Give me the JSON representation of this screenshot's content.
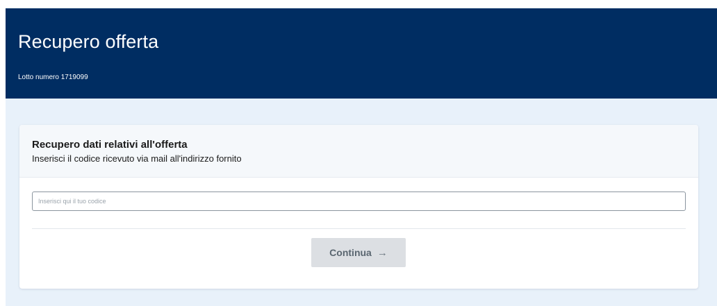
{
  "header": {
    "title": "Recupero offerta",
    "subtitle": "Lotto numero 1719099"
  },
  "card": {
    "title": "Recupero dati relativi all'offerta",
    "subtitle": "Inserisci il codice ricevuto via mail all'indirizzo fornito",
    "code_input": {
      "value": "",
      "placeholder": "Inserisci qui il tuo codice"
    },
    "continue_button": {
      "label": "Continua",
      "icon": "arrow-right-icon",
      "icon_glyph": "→",
      "disabled": true
    }
  },
  "colors": {
    "header_bg": "#002d62",
    "content_bg": "#e8f1fa",
    "button_disabled_bg": "#dcdfe3"
  }
}
